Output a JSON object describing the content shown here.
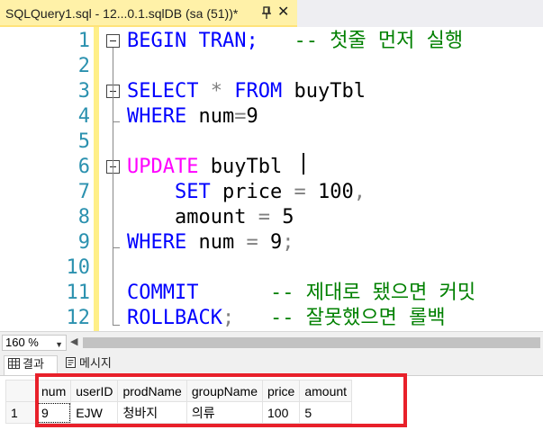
{
  "tab": {
    "title": "SQLQuery1.sql - 12...0.1.sqlDB (sa (51))*",
    "close": "✕"
  },
  "editor": {
    "line_numbers": [
      "1",
      "2",
      "3",
      "4",
      "5",
      "6",
      "7",
      "8",
      "9",
      "10",
      "11",
      "12"
    ],
    "lines": {
      "l1_kw": "BEGIN TRAN;",
      "l1_cm": "-- 첫줄 먼저 실행",
      "l3_kw1": "SELECT",
      "l3_op": "*",
      "l3_kw2": "FROM",
      "l3_txt": "buyTbl",
      "l4_kw": "WHERE",
      "l4_txt": "num",
      "l4_op": "=",
      "l4_val": "9",
      "l6_kw": "UPDATE",
      "l6_txt": "buyTbl",
      "l7_kw": "SET",
      "l7_txt": "price",
      "l7_op": "=",
      "l7_val": "100",
      "l7_op2": ",",
      "l8_txt": "amount",
      "l8_op": "=",
      "l8_val": "5",
      "l9_kw": "WHERE",
      "l9_txt": "num",
      "l9_op": "=",
      "l9_val": "9",
      "l9_op2": ";",
      "l11_kw": "COMMIT",
      "l11_cm": "-- 제대로 됐으면 커밋",
      "l12_kw": "ROLLBACK",
      "l12_op": ";",
      "l12_cm": "-- 잘못했으면 롤백"
    }
  },
  "zoom": {
    "value": "160 %"
  },
  "results_tabs": [
    {
      "label": "결과",
      "icon": "grid-icon"
    },
    {
      "label": "메시지",
      "icon": "message-icon"
    }
  ],
  "grid": {
    "columns": [
      "num",
      "userID",
      "prodName",
      "groupName",
      "price",
      "amount"
    ],
    "rows": [
      {
        "row_number": "1",
        "cells": [
          "9",
          "EJW",
          "청바지",
          "의류",
          "100",
          "5"
        ]
      }
    ]
  },
  "colors": {
    "keyword": "#0000ff",
    "dml_keyword": "#ff00ff",
    "comment": "#008000",
    "line_number": "#2b91af",
    "highlight_box": "#e8202a",
    "active_tab": "#fff1a8"
  }
}
